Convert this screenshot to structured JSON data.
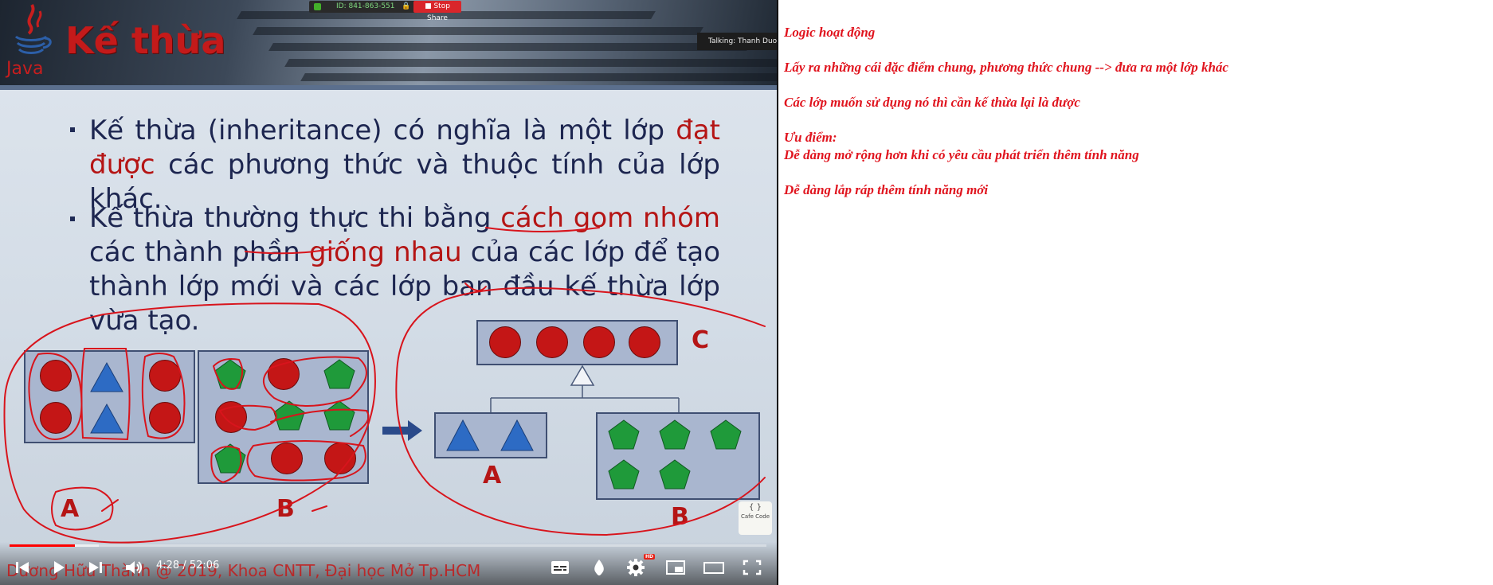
{
  "video": {
    "slide_title": "Kế thừa",
    "java_word": "Java",
    "zoom": {
      "meeting_id": "ID: 841-863-551",
      "stop_share": "Stop Share"
    },
    "talking": "Talking: Thanh Duong",
    "bullets": [
      {
        "parts": [
          "Kế thừa (inheritance) có nghĩa là một lớp ",
          "đạt được",
          " các phương thức và thuộc tính của lớp khác."
        ]
      },
      {
        "parts": [
          "Kế thừa thường thực thi bằng ",
          "cách gom nhóm",
          " các thành phần ",
          "giống nhau",
          " của các lớp để tạo thành lớp mới và các lớp ban đầu kế thừa lớp vừa tạo."
        ]
      }
    ],
    "diagram_labels": {
      "left_a": "A",
      "left_b": "B",
      "right_c": "C",
      "right_a": "A",
      "right_b": "B"
    },
    "cafe_logo": "Cafe Code",
    "watermark": "Dương Hữu Thành @ 2019, Khoa CNTT, Đại học Mở Tp.HCM",
    "player": {
      "time": "4:28 / 52:06",
      "progress_fraction": 0.086,
      "hd_badge": "HD",
      "icons": [
        "skip-previous-icon",
        "play-icon",
        "skip-next-icon",
        "volume-icon",
        "subtitles-icon",
        "autoplay-icon",
        "settings-icon",
        "miniplayer-icon",
        "theater-mode-icon",
        "fullscreen-icon"
      ]
    }
  },
  "notes": {
    "line1": "Logic hoạt động",
    "line2": "Lấy ra những cái đặc điểm chung, phương thức chung --> đưa ra một lớp khác",
    "line3": "Các lớp muốn sử dụng nó thì cần kế thừa lại là được",
    "line4": "Ưu điểm:",
    "line5": "Dễ dàng mở rộng hơn khi có yêu cầu phát triển thêm tính năng",
    "line6": "Dễ dàng lắp ráp thêm tính năng mới"
  },
  "colors": {
    "slide_red": "#c41a1a",
    "notes_red": "#e0141e",
    "slide_text": "#1d2650",
    "shape_circle": "#c41616",
    "shape_triangle": "#2d6bc4",
    "shape_pentagon": "#1f9a3a",
    "box_fill": "#a9b6cf"
  }
}
